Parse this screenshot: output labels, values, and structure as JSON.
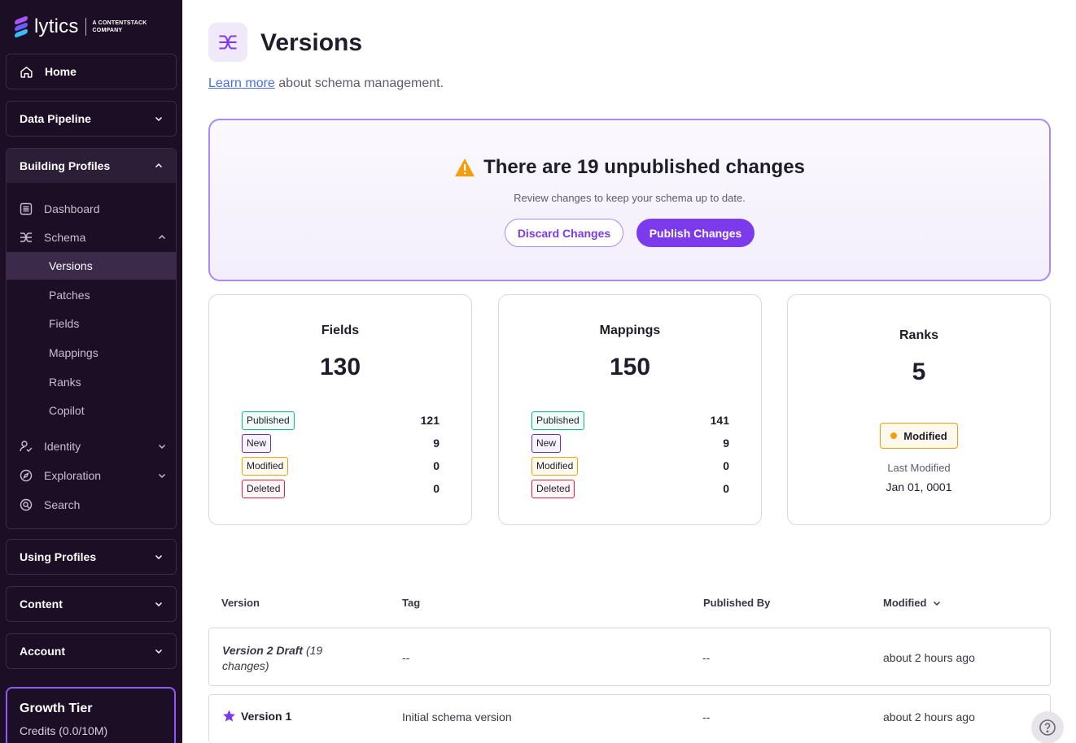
{
  "brand": {
    "name": "lytics",
    "sub": "A CONTENTSTACK COMPANY"
  },
  "sidebar": {
    "home": "Home",
    "data_pipeline": "Data Pipeline",
    "building_profiles": "Building Profiles",
    "dashboard": "Dashboard",
    "schema": "Schema",
    "schema_items": [
      "Versions",
      "Patches",
      "Fields",
      "Mappings",
      "Ranks",
      "Copilot"
    ],
    "identity": "Identity",
    "exploration": "Exploration",
    "search": "Search",
    "using_profiles": "Using Profiles",
    "content": "Content",
    "account": "Account",
    "tier": {
      "title": "Growth Tier",
      "credits": "Credits (0.0/10M)"
    }
  },
  "page": {
    "title": "Versions",
    "learn_link": "Learn more",
    "learn_rest": " about schema management."
  },
  "banner": {
    "title": "There are 19 unpublished changes",
    "subtitle": "Review changes to keep your schema up to date.",
    "discard": "Discard Changes",
    "publish": "Publish Changes"
  },
  "cards": {
    "fields": {
      "title": "Fields",
      "total": "130",
      "rows": [
        {
          "label": "Published",
          "value": "121"
        },
        {
          "label": "New",
          "value": "9"
        },
        {
          "label": "Modified",
          "value": "0"
        },
        {
          "label": "Deleted",
          "value": "0"
        }
      ]
    },
    "mappings": {
      "title": "Mappings",
      "total": "150",
      "rows": [
        {
          "label": "Published",
          "value": "141"
        },
        {
          "label": "New",
          "value": "9"
        },
        {
          "label": "Modified",
          "value": "0"
        },
        {
          "label": "Deleted",
          "value": "0"
        }
      ]
    },
    "ranks": {
      "title": "Ranks",
      "total": "5",
      "status": "Modified",
      "last_modified_label": "Last Modified",
      "last_modified_value": "Jan 01, 0001"
    }
  },
  "table": {
    "headers": {
      "version": "Version",
      "tag": "Tag",
      "published_by": "Published By",
      "modified": "Modified"
    },
    "rows": [
      {
        "version": "Version 2 Draft",
        "version_note": " (19 changes)",
        "tag": "--",
        "published_by": "--",
        "modified": "about 2 hours ago"
      },
      {
        "version": "Version 1",
        "tag": "Initial schema version",
        "published_by": "--",
        "modified": "about 2 hours ago"
      }
    ]
  },
  "colors": {
    "accent": "#7c3aed",
    "sidebar_bg": "#1c0e24",
    "warning": "#f59e0b"
  }
}
